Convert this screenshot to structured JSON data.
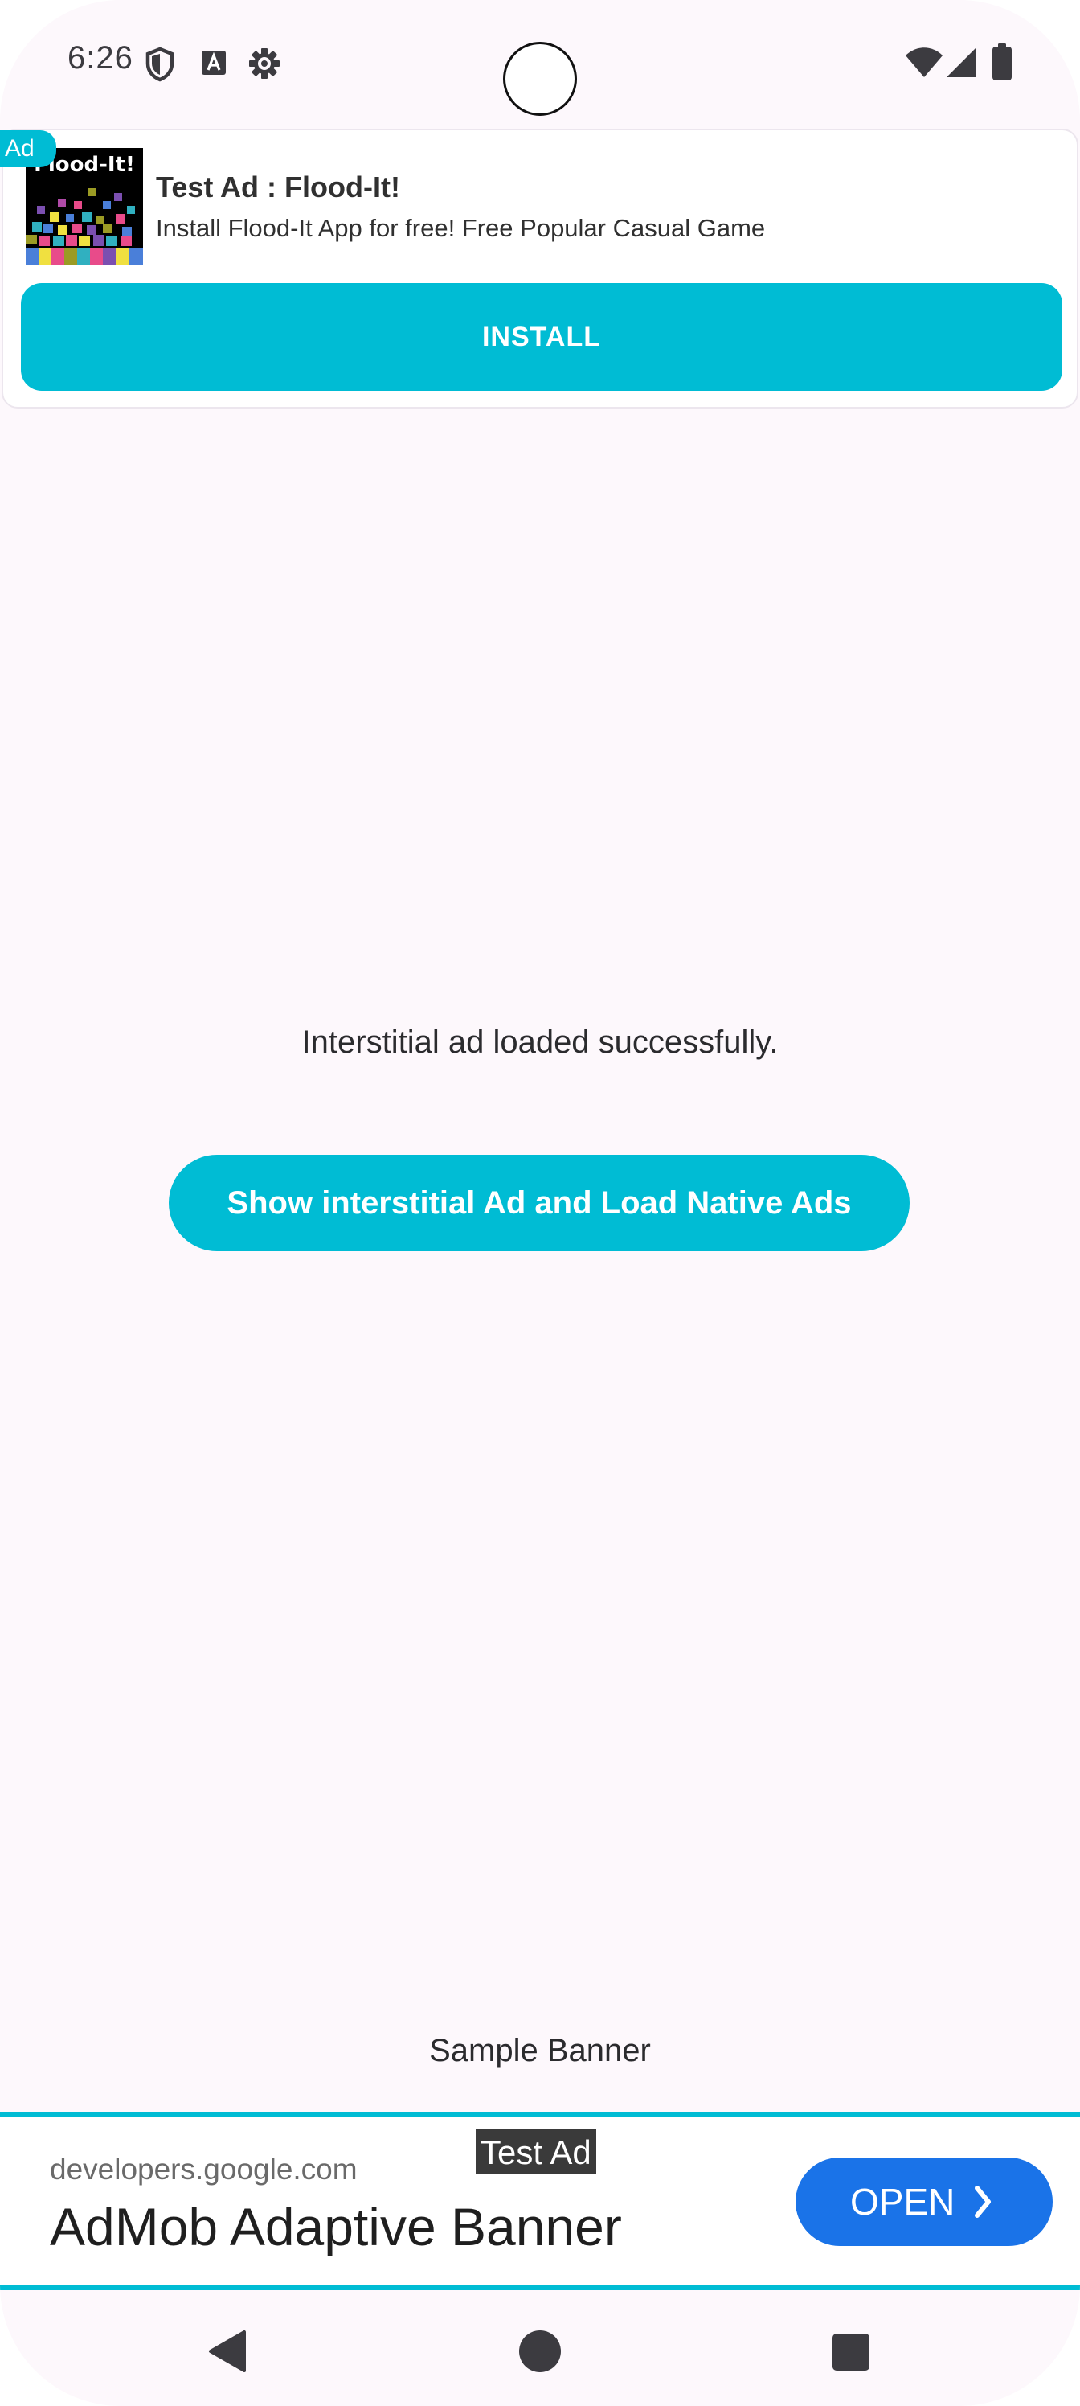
{
  "status_bar": {
    "time": "6:26",
    "left_icons": [
      "shield-icon",
      "font-a-icon",
      "settings-icon"
    ],
    "right_icons": [
      "wifi-icon",
      "signal-icon",
      "battery-icon"
    ]
  },
  "native_ad": {
    "badge": "Ad",
    "icon_title": "Flood-It!",
    "headline": "Test Ad : Flood-It!",
    "body": "Install Flood-It App for free! Free Popular Casual Game",
    "install_label": "INSTALL",
    "accent_color": "#00bcd4"
  },
  "main": {
    "status_message": "Interstitial ad loaded successfully.",
    "show_ad_button_label": "Show interstitial Ad and Load Native Ads",
    "banner_label": "Sample Banner"
  },
  "banner_ad": {
    "test_ad_label": "Test Ad",
    "url": "developers.google.com",
    "title": "AdMob Adaptive Banner",
    "open_label": "OPEN",
    "open_button_color": "#1a73e8"
  },
  "nav_bar": {
    "items": [
      "back-icon",
      "home-icon",
      "recents-icon"
    ]
  }
}
